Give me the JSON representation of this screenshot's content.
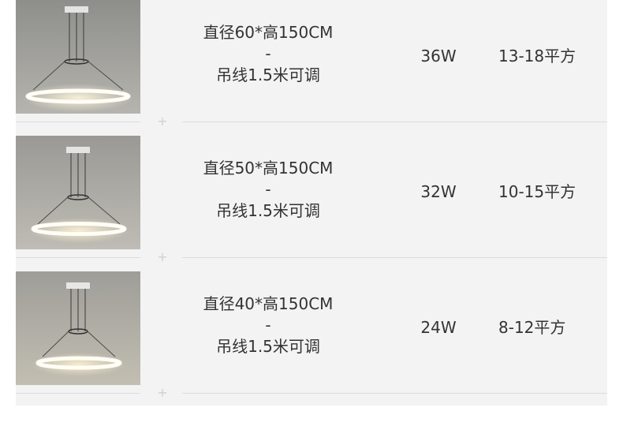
{
  "rows": [
    {
      "size_line1": "直径60*高150CM",
      "size_line2": "-",
      "size_line3": "吊线1.5米可调",
      "power": "36W",
      "area": "13-18平方"
    },
    {
      "size_line1": "直径50*高150CM",
      "size_line2": "-",
      "size_line3": "吊线1.5米可调",
      "power": "32W",
      "area": "10-15平方"
    },
    {
      "size_line1": "直径40*高150CM",
      "size_line2": "-",
      "size_line3": "吊线1.5米可调",
      "power": "24W",
      "area": "8-12平方"
    }
  ],
  "separator_icon": "+",
  "colors": {
    "table_bg": "#f3f3f3",
    "text": "#333333",
    "divider": "#dcdcdc"
  }
}
